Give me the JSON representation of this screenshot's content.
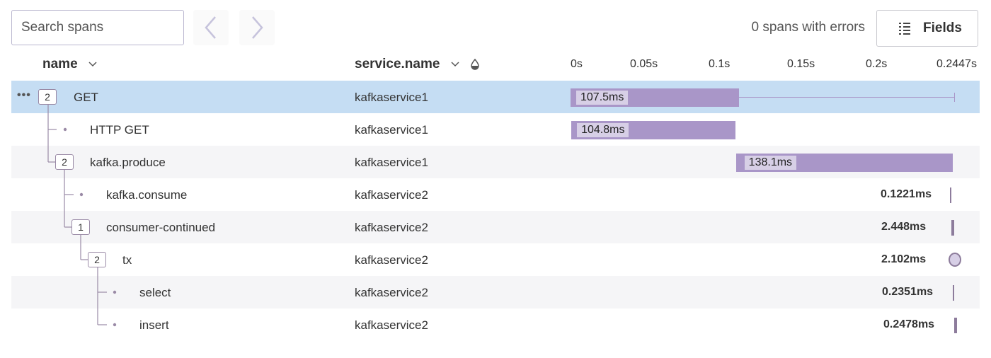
{
  "toolbar": {
    "search_placeholder": "Search spans",
    "prev_icon": "chevron-left-icon",
    "next_icon": "chevron-right-icon",
    "errors_text": "0 spans with errors",
    "fields_label": "Fields",
    "fields_icon": "list-icon"
  },
  "columns": {
    "name": "name",
    "service": "service.name",
    "service_icon": "droplet-icon"
  },
  "timeline": {
    "ticks": [
      "0s",
      "0.05s",
      "0.1s",
      "0.15s",
      "0.2s",
      "0.2447s"
    ],
    "bar_color": "#a996c8",
    "selected_row_color": "#c5ddf3"
  },
  "spans": [
    {
      "name": "GET",
      "service": "kafkaservice1",
      "children": "2",
      "duration": "107.5ms",
      "start_s": 0.0,
      "end_s": 0.1075
    },
    {
      "name": "HTTP GET",
      "service": "kafkaservice1",
      "children": "",
      "duration": "104.8ms",
      "start_s": 0.0005,
      "end_s": 0.1053
    },
    {
      "name": "kafka.produce",
      "service": "kafkaservice1",
      "children": "2",
      "duration": "138.1ms",
      "start_s": 0.1055,
      "end_s": 0.2436
    },
    {
      "name": "kafka.consume",
      "service": "kafkaservice2",
      "children": "",
      "duration": "0.1221ms",
      "start_s": 0.2436,
      "end_s": 0.2437
    },
    {
      "name": "consumer-continued",
      "service": "kafkaservice2",
      "children": "1",
      "duration": "2.448ms",
      "start_s": 0.2436,
      "end_s": 0.2437
    },
    {
      "name": "tx",
      "service": "kafkaservice2",
      "children": "2",
      "duration": "2.102ms",
      "start_s": 0.2437,
      "end_s": 0.2447
    },
    {
      "name": "select",
      "service": "kafkaservice2",
      "children": "",
      "duration": "0.2351ms",
      "start_s": 0.244,
      "end_s": 0.2442
    },
    {
      "name": "insert",
      "service": "kafkaservice2",
      "children": "",
      "duration": "0.2478ms",
      "start_s": 0.2443,
      "end_s": 0.2446
    }
  ]
}
